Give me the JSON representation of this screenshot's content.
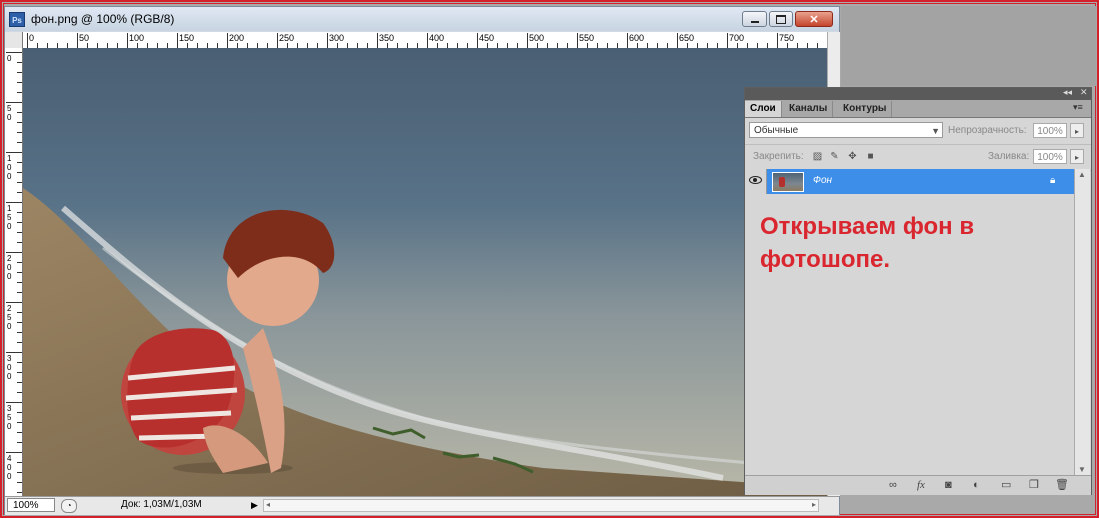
{
  "window": {
    "title": "фон.png @ 100% (RGB/8)",
    "app_icon": "Ps"
  },
  "ruler": {
    "top_labels": [
      "0",
      "50",
      "100",
      "150",
      "200",
      "250",
      "300",
      "350",
      "400",
      "450",
      "500",
      "550",
      "600",
      "650",
      "700",
      "750"
    ],
    "left_labels": [
      "0",
      "50",
      "100",
      "150",
      "200",
      "250",
      "300",
      "350",
      "400"
    ]
  },
  "status": {
    "zoom": "100%",
    "doc_info": "Док: 1,03M/1,03M"
  },
  "layers_panel": {
    "tabs": [
      "Слои",
      "Каналы",
      "Контуры"
    ],
    "blend_mode": "Обычные",
    "opacity_label": "Непрозрачность:",
    "opacity_value": "100%",
    "lock_label": "Закрепить:",
    "fill_label": "Заливка:",
    "fill_value": "100%",
    "layer_name": "Фон",
    "annotation": "Открываем фон в фотошопе."
  },
  "colors": {
    "selected_layer": "#3d8ee8",
    "annotation": "#d9262f",
    "frame_border": "#d4202a"
  }
}
